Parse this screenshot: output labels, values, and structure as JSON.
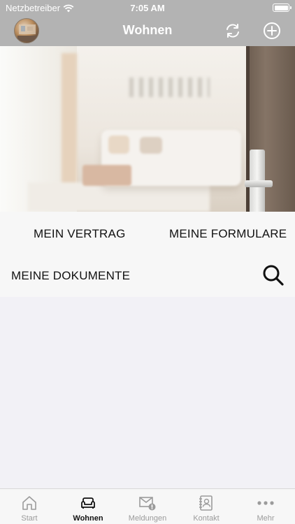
{
  "status_bar": {
    "carrier": "Netzbetreiber",
    "time": "7:05 AM"
  },
  "nav": {
    "title": "Wohnen"
  },
  "menu": {
    "vertrag": "MEIN VERTRAG",
    "formulare": "MEINE FORMULARE",
    "dokumente": "MEINE DOKUMENTE"
  },
  "tabs": [
    {
      "label": "Start",
      "icon": "house-icon"
    },
    {
      "label": "Wohnen",
      "icon": "sofa-icon"
    },
    {
      "label": "Meldungen",
      "icon": "mail-alert-icon"
    },
    {
      "label": "Kontakt",
      "icon": "contact-book-icon"
    },
    {
      "label": "Mehr",
      "icon": "more-dots-icon"
    }
  ],
  "active_tab": "Wohnen",
  "colors": {
    "nav_background": "#b3b3b3",
    "inactive_tab": "#9b9b9b",
    "active_tab": "#111111",
    "page_background": "#f2f1f6"
  }
}
